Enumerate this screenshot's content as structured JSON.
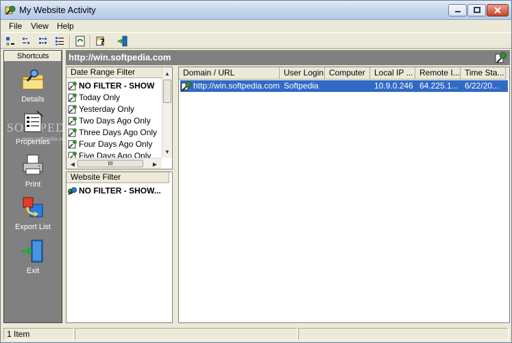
{
  "window": {
    "title": "My Website Activity"
  },
  "menu": [
    "File",
    "View",
    "Help"
  ],
  "toolbar": {
    "buttons": [
      "large-icons-icon",
      "small-icons-icon",
      "list-view-icon",
      "details-view-icon",
      "refresh-icon",
      "help-icon",
      "exit-icon"
    ]
  },
  "shortcuts": {
    "header": "Shortcuts",
    "items": [
      {
        "label": "Details",
        "icon": "details-icon"
      },
      {
        "label": "Properties",
        "icon": "properties-icon"
      },
      {
        "label": "Print",
        "icon": "print-icon"
      },
      {
        "label": "Export List",
        "icon": "export-list-icon"
      },
      {
        "label": "Exit",
        "icon": "exit-door-icon"
      }
    ]
  },
  "address": {
    "url": "http://win.softpedia.com"
  },
  "date_filter": {
    "header": "Date Range Filter",
    "items": [
      "NO FILTER - SHOW",
      "Today Only",
      "Yesterday Only",
      "Two Days Ago Only",
      "Three Days Ago Only",
      "Four Days Ago Only",
      "Five Days Ago Only"
    ],
    "hscroll_thumb_text": "III"
  },
  "website_filter": {
    "header": "Website Filter",
    "items": [
      "NO FILTER - SHOW..."
    ]
  },
  "list": {
    "columns": [
      "Domain / URL",
      "User Login",
      "Computer",
      "Local IP ...",
      "Remote I...",
      "Time Sta..."
    ],
    "rows": [
      {
        "domain": "http://win.softpedia.com",
        "user": "Softpedia",
        "computer": "",
        "local_ip": "10.9.0.246",
        "remote_ip": "64.225.1...",
        "time": "6/22/20..."
      }
    ]
  },
  "status": {
    "count": "1 Item",
    "panel2": "",
    "panel3": ""
  },
  "watermark": {
    "text": "SOFTPEDIA",
    "sub": "www.softpedia.com"
  },
  "colors": {
    "selection": "#316ac5",
    "panel_dark": "#808080"
  }
}
